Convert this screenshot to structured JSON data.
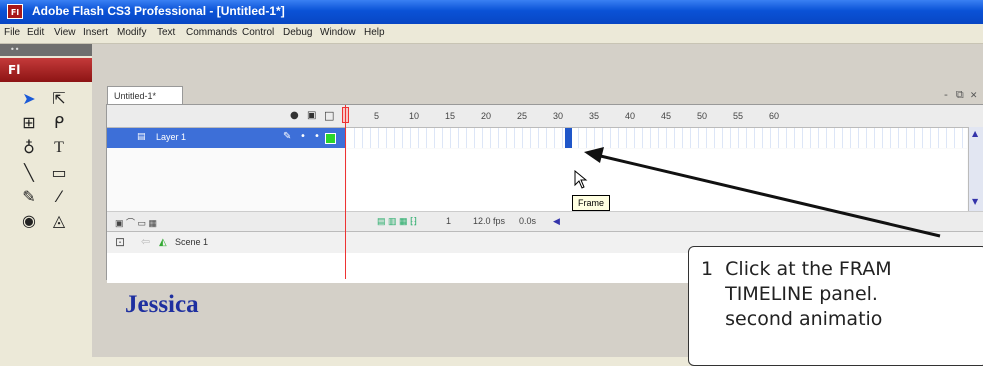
{
  "window": {
    "title": "Adobe Flash CS3 Professional - [Untitled-1*]",
    "app_icon_label": "Fl"
  },
  "menubar": {
    "items": [
      "File",
      "Edit",
      "View",
      "Insert",
      "Modify",
      "Text",
      "Commands",
      "Control",
      "Debug",
      "Window",
      "Help"
    ]
  },
  "tools": {
    "brand": "Fl"
  },
  "document": {
    "tab_label": "Untitled-1*",
    "window_controls": "- ⧉ ✕"
  },
  "timeline": {
    "ruler_numbers": [
      "5",
      "10",
      "15",
      "20",
      "25",
      "30",
      "35",
      "40",
      "45",
      "50",
      "55",
      "60"
    ],
    "layer_name": "Layer 1",
    "frame_number": "1",
    "fps": "12.0 fps",
    "time": "0.0s"
  },
  "scene": {
    "name": "Scene 1"
  },
  "stage": {
    "text": "Jessica"
  },
  "tooltip": {
    "text": "Frame"
  },
  "callout": {
    "text": "1  Click at the FRAM\n    TIMELINE panel.\n    second animatio"
  }
}
